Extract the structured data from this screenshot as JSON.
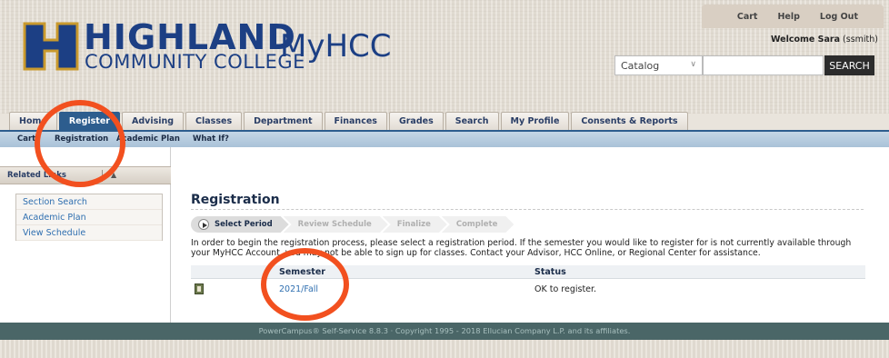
{
  "header": {
    "logo_title": "HIGHLAND",
    "logo_subtitle": "COMMUNITY COLLEGE",
    "logo_myhcc": "MyHCC",
    "util_links": [
      "Cart",
      "Help",
      "Log Out"
    ],
    "welcome_prefix": "Welcome Sara",
    "welcome_user": "(ssmith)",
    "catalog_select": "Catalog",
    "search_button": "SEARCH",
    "brand_color": "#1c3f84"
  },
  "tabs": [
    {
      "label": "Home",
      "active": false
    },
    {
      "label": "Register",
      "active": true
    },
    {
      "label": "Advising",
      "active": false
    },
    {
      "label": "Classes",
      "active": false
    },
    {
      "label": "Department",
      "active": false
    },
    {
      "label": "Finances",
      "active": false
    },
    {
      "label": "Grades",
      "active": false
    },
    {
      "label": "Search",
      "active": false
    },
    {
      "label": "My Profile",
      "active": false
    },
    {
      "label": "Consents & Reports",
      "active": false
    }
  ],
  "subnav": [
    "Cart",
    "Registration",
    "Academic Plan",
    "What If?"
  ],
  "sidebar": {
    "heading": "Related Links",
    "links": [
      "Section Search",
      "Academic Plan",
      "View Schedule"
    ]
  },
  "main": {
    "title": "Registration",
    "steps": [
      "Select Period",
      "Review Schedule",
      "Finalize",
      "Complete"
    ],
    "instructions": "In order to begin the registration process, please select a registration period. If the semester you would like to register for is not currently available through your MyHCC Account, you may not be able to sign up for classes. Contact your Advisor, HCC Online, or Regional Center for assistance.",
    "table": {
      "columns": [
        "Semester",
        "Status"
      ],
      "rows": [
        {
          "semester": "2021/Fall",
          "status": "OK to register."
        }
      ]
    }
  },
  "footer": "PowerCampus® Self-Service 8.8.3 · Copyright 1995 - 2018 Ellucian Company L.P. and its affiliates.",
  "annotation_color": "#f2501f"
}
